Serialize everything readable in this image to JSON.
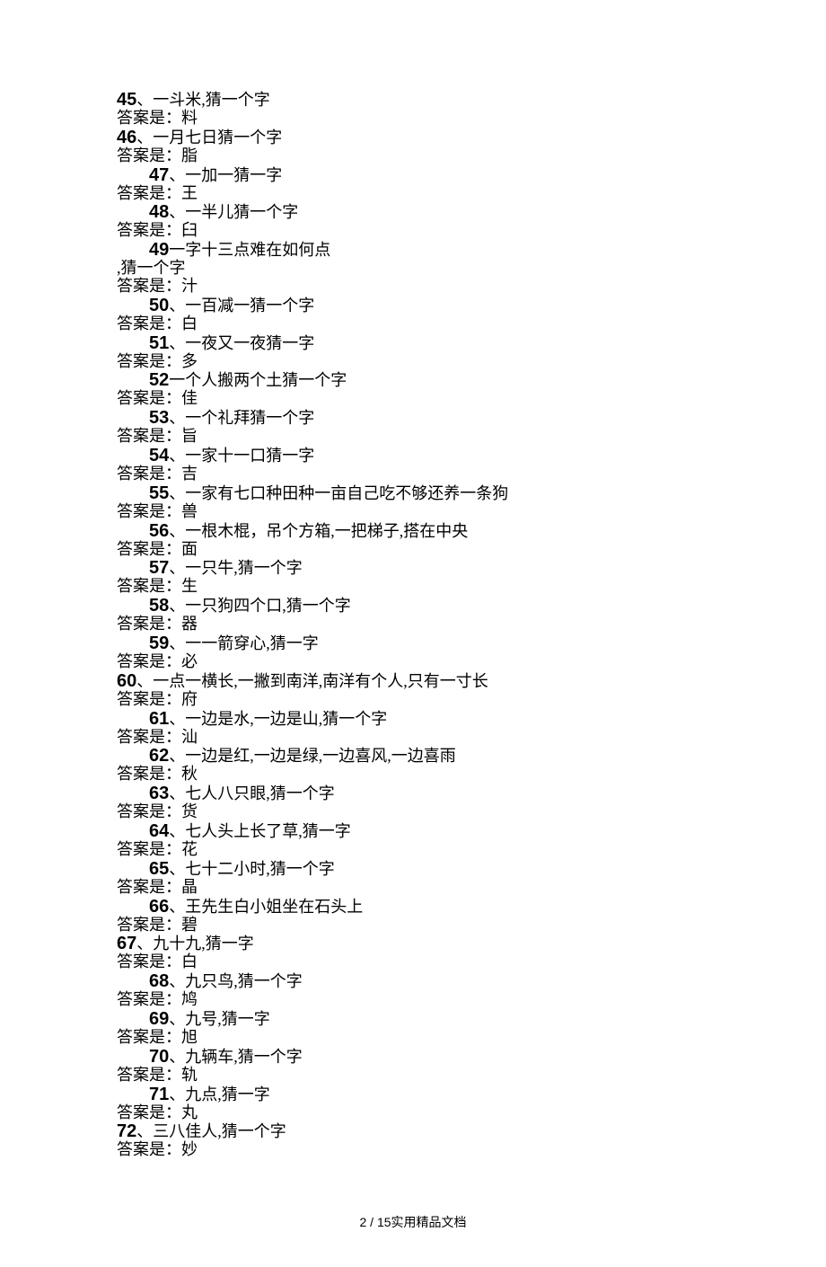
{
  "riddles": [
    {
      "num": "45",
      "text": "、一斗米,猜一个字",
      "indent": "none",
      "answer": "答案是：料"
    },
    {
      "num": "46",
      "text": "、一月七日猜一个字",
      "indent": "none",
      "answer": "答案是：脂"
    },
    {
      "num": "47",
      "text": "、一加一猜一字",
      "indent": "small",
      "answer": "答案是：王"
    },
    {
      "num": "48",
      "text": "、一半儿猜一个字",
      "indent": "small",
      "answer": "答案是：臼"
    },
    {
      "num": "49",
      "text": "一字十三点难在如何点",
      "indent": "small",
      "extra": ",猜一个字",
      "answer": "答案是：汁"
    },
    {
      "num": "50",
      "text": "、一百减一猜一个字",
      "indent": "small",
      "answer": "答案是：白"
    },
    {
      "num": "51",
      "text": "、一夜又一夜猜一字",
      "indent": "small",
      "answer": "答案是：多"
    },
    {
      "num": "52",
      "text": "一个人搬两个土猜一个字",
      "indent": "small",
      "answer": "答案是：佳"
    },
    {
      "num": "53",
      "text": "、一个礼拜猜一个字",
      "indent": "small",
      "answer": "答案是：旨"
    },
    {
      "num": "54",
      "text": "、一家十一口猜一字",
      "indent": "small",
      "answer": "答案是：吉"
    },
    {
      "num": "55",
      "text": "、一家有七口种田种一亩自己吃不够还养一条狗",
      "indent": "small",
      "answer": "答案是：兽"
    },
    {
      "num": "56",
      "text": "、一根木棍，吊个方箱,一把梯子,搭在中央",
      "indent": "small",
      "answer": "答案是：面"
    },
    {
      "num": "57",
      "text": "、一只牛,猜一个字",
      "indent": "small",
      "answer": "答案是：生"
    },
    {
      "num": "58",
      "text": "、一只狗四个口,猜一个字",
      "indent": "small",
      "answer": "答案是：器"
    },
    {
      "num": "59",
      "text": "、一一箭穿心,猜一字",
      "indent": "small",
      "answer": "答案是：必"
    },
    {
      "num": "60",
      "text": "、一点一横长,一撇到南洋,南洋有个人,只有一寸长",
      "indent": "none",
      "answer": "答案是：府"
    },
    {
      "num": "61",
      "text": "、一边是水,一边是山,猜一个字",
      "indent": "small",
      "answer": "答案是：汕"
    },
    {
      "num": "62",
      "text": "、一边是红,一边是绿,一边喜风,一边喜雨",
      "indent": "small",
      "answer": "答案是：秋"
    },
    {
      "num": "63",
      "text": "、七人八只眼,猜一个字",
      "indent": "small",
      "answer": "答案是：货"
    },
    {
      "num": "64",
      "text": "、七人头上长了草,猜一字",
      "indent": "small",
      "answer": "答案是：花"
    },
    {
      "num": "65",
      "text": "、七十二小时,猜一个字",
      "indent": "small",
      "answer": "答案是：晶"
    },
    {
      "num": "66",
      "text": "、王先生白小姐坐在石头上",
      "indent": "small",
      "answer": "答案是：碧"
    },
    {
      "num": "67",
      "text": "、九十九,猜一字",
      "indent": "none",
      "answer": "答案是：白"
    },
    {
      "num": "68",
      "text": "、九只鸟,猜一个字",
      "indent": "small",
      "answer": "答案是：鸠"
    },
    {
      "num": "69",
      "text": "、九号,猜一字",
      "indent": "small",
      "answer": "答案是：旭"
    },
    {
      "num": "70",
      "text": "、九辆车,猜一个字",
      "indent": "small",
      "answer": "答案是：轨"
    },
    {
      "num": "71",
      "text": "、九点,猜一字",
      "indent": "small",
      "answer": "答案是：丸"
    },
    {
      "num": "72",
      "text": "、三八佳人,猜一个字",
      "indent": "none",
      "answer": "答案是：妙"
    }
  ],
  "footer": {
    "page": "2 / 15",
    "label": "实用精品文档"
  }
}
